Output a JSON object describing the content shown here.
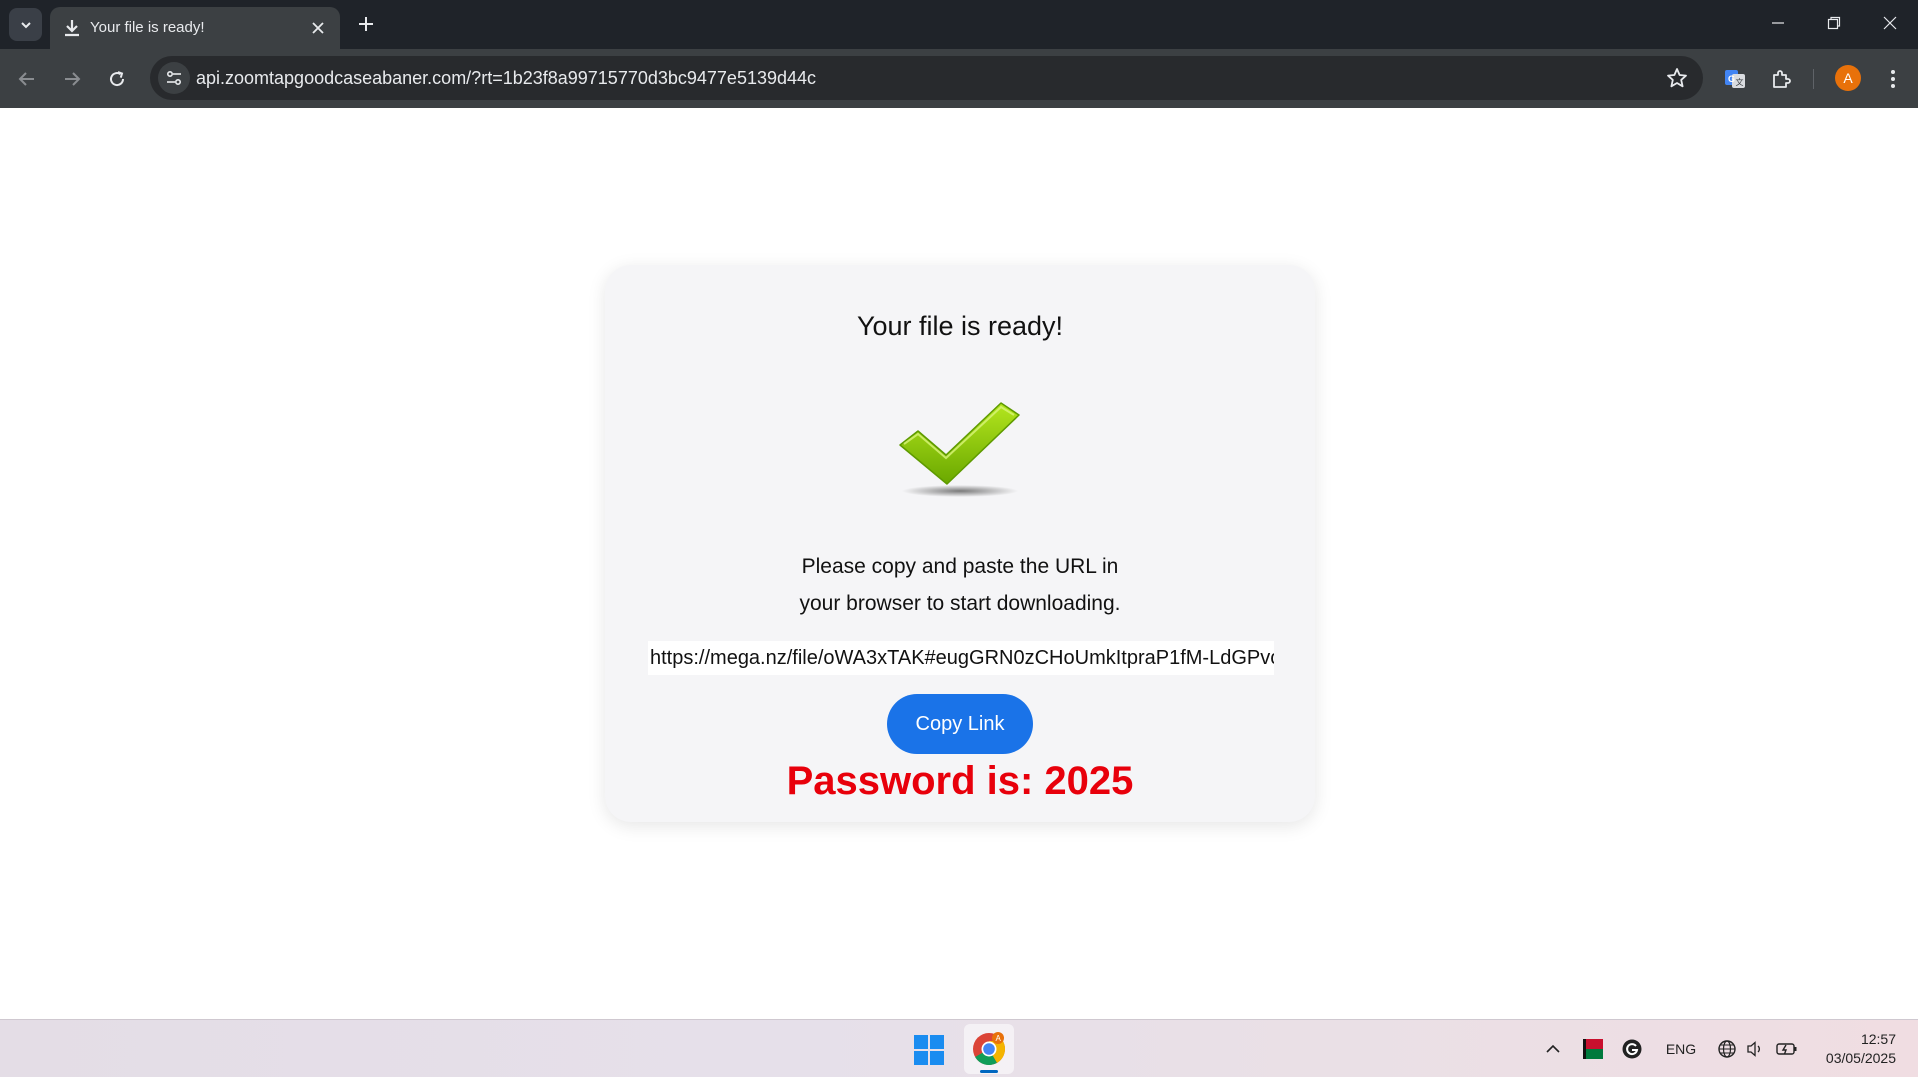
{
  "browser": {
    "tab": {
      "title": "Your file is ready!",
      "icon": "download-icon"
    },
    "address_bar": {
      "url": "api.zoomtapgoodcaseabaner.com/?rt=1b23f8a99715770d3bc9477e5139d44c"
    },
    "profile_initial": "A"
  },
  "page": {
    "title": "Your file is ready!",
    "instruction_line1": "Please copy and paste the URL in",
    "instruction_line2": "your browser to start downloading.",
    "download_link": "https://mega.nz/file/oWA3xTAK#eugGRN0zCHoUmkItpraP1fM-LdGPvc",
    "copy_button_label": "Copy Link",
    "password_text": "Password is: 2025"
  },
  "taskbar": {
    "language": "ENG",
    "time": "12:57",
    "date": "03/05/2025"
  },
  "colors": {
    "accent_blue": "#1a73e8",
    "password_red": "#e8000b",
    "check_green": "#8cc800"
  }
}
